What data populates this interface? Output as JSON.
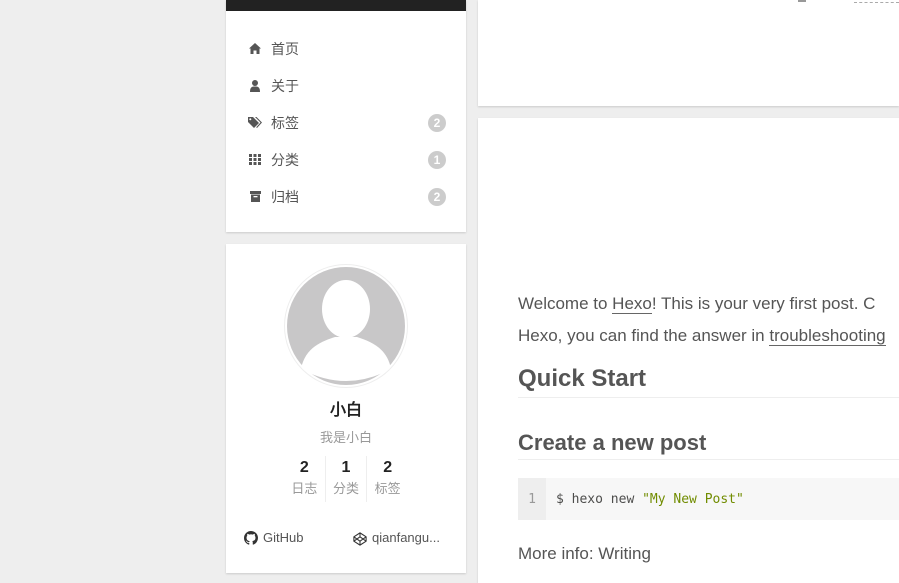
{
  "menu": {
    "items": [
      {
        "label": "首页",
        "icon": "home-icon"
      },
      {
        "label": "关于",
        "icon": "user-icon"
      },
      {
        "label": "标签",
        "icon": "tags-icon",
        "badge": "2"
      },
      {
        "label": "分类",
        "icon": "th-icon",
        "badge": "1"
      },
      {
        "label": "归档",
        "icon": "archive-icon",
        "badge": "2"
      }
    ]
  },
  "profile": {
    "name": "小白",
    "description": "我是小白",
    "stats": [
      {
        "count": "2",
        "label": "日志"
      },
      {
        "count": "1",
        "label": "分类"
      },
      {
        "count": "2",
        "label": "标签"
      }
    ],
    "links": [
      {
        "label": "GitHub",
        "icon": "github-icon"
      },
      {
        "label": "qianfangu...",
        "icon": "codepen-icon"
      }
    ]
  },
  "post": {
    "para1": {
      "before": "Welcome to ",
      "link": "Hexo",
      "after": "! This is your very first post. C"
    },
    "para2": {
      "before": "Hexo, you can find the answer in ",
      "link": "troubleshooting"
    },
    "heading_quick_start": "Quick Start",
    "heading_create_post": "Create a new post",
    "code": {
      "line_number": "1",
      "command": "$ hexo new ",
      "string": "\"My New Post\""
    },
    "more_info": "More info: Writing"
  },
  "colors": {
    "topbar": "#222222",
    "badge": "#cccccc",
    "background": "#eeeeee",
    "code_string": "#718c00"
  }
}
